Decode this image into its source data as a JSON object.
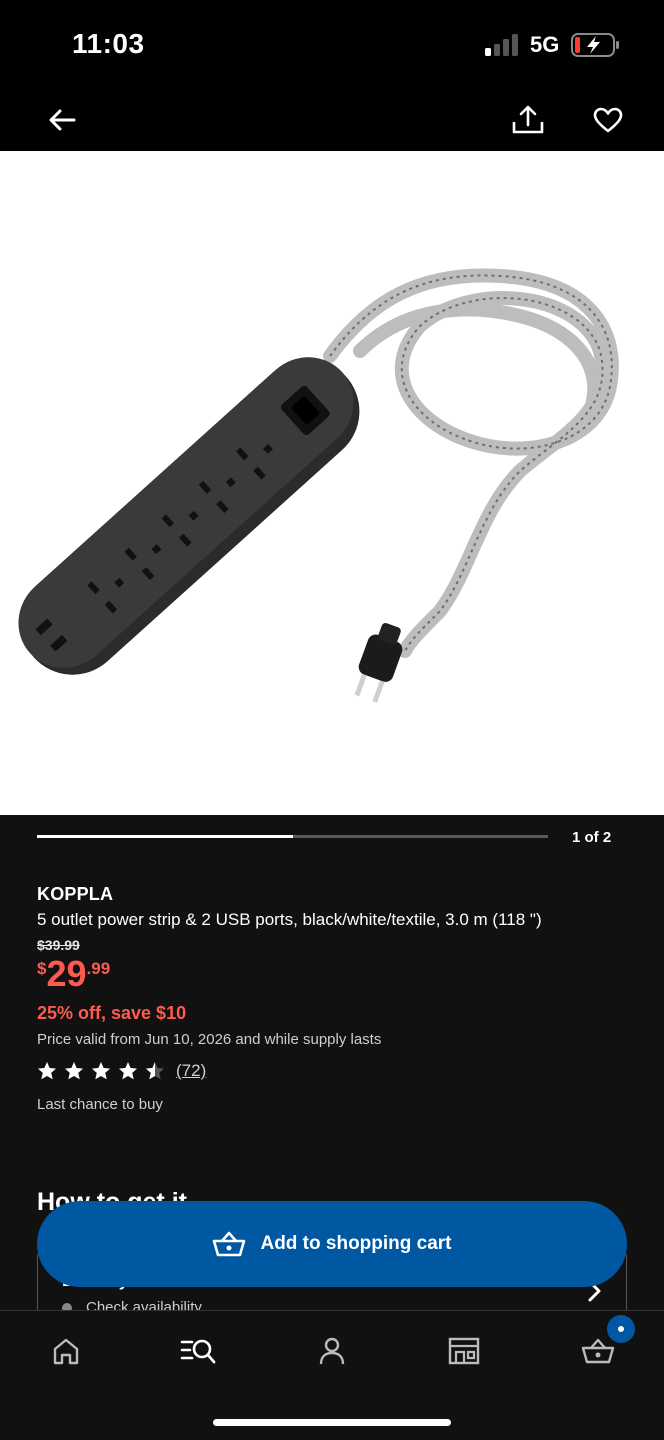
{
  "status_bar": {
    "time": "11:03",
    "network": "5G",
    "signal_icon": "signal-bars-icon",
    "battery_icon": "battery-charging-icon"
  },
  "top_nav": {
    "back_icon": "arrow-left-icon",
    "share_icon": "share-icon",
    "favorite_icon": "heart-icon"
  },
  "image_carousel": {
    "page_indicator": "1 of 2",
    "progress": 0.5
  },
  "product": {
    "brand": "KOPPLA",
    "description": "5 outlet power strip & 2 USB ports, black/white/textile, 3.0 m (118 \")",
    "old_price": "$39.99",
    "price": {
      "currency": "$",
      "integer": "29",
      "decimal": ".99"
    },
    "discount": "25% off, save $10",
    "validity": "Price valid from Jun 10, 2026 and while supply lasts",
    "rating": 4.5,
    "review_count": "(72)",
    "availability_note": "Last chance to buy"
  },
  "how_to_get_it": {
    "title": "How to get it",
    "delivery_label": "Delivery",
    "check_availability": "Check availability"
  },
  "add_to_cart": {
    "label": "Add to shopping cart",
    "icon": "basket-icon"
  },
  "tab_bar": {
    "items": [
      "home-icon",
      "search-icon",
      "profile-icon",
      "store-icon",
      "cart-icon"
    ]
  },
  "colors": {
    "accent_blue": "#0058a3",
    "sale_red": "#ff5a4e",
    "background": "#111111"
  }
}
